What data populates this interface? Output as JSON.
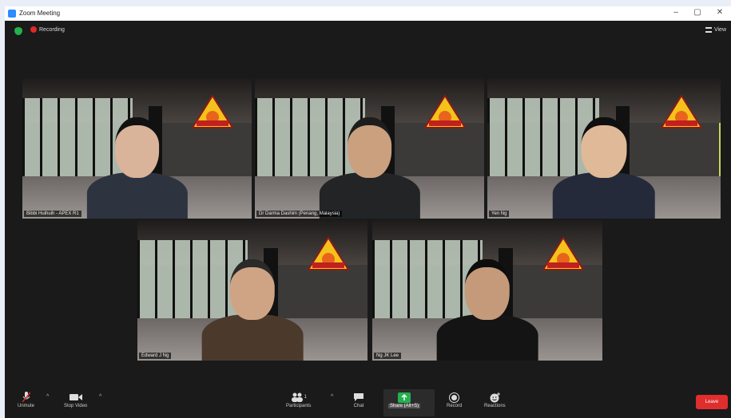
{
  "window": {
    "title": "Zoom Meeting",
    "controls": [
      "–",
      "▢",
      "✕"
    ]
  },
  "topbar": {
    "recording": "Recording",
    "view": "View"
  },
  "participants": [
    {
      "name": "Bibbi Huihuih - APEX R1",
      "skin": "#d9b39a",
      "hair": "#111111",
      "shirt": "#2e3340",
      "active": false
    },
    {
      "name": "Dr Darma Dashim (Penang, Malaysia)",
      "skin": "#caa07f",
      "hair": "#1d1d1d",
      "shirt": "#222426",
      "active": false
    },
    {
      "name": "Yen Ng",
      "skin": "#e0b998",
      "hair": "#0f0f0f",
      "shirt": "#252a3a",
      "active": true
    },
    {
      "name": "Edward J Ng",
      "skin": "#cfa484",
      "hair": "#2a2a2a",
      "shirt": "#4b3a2c",
      "active": false
    },
    {
      "name": "Ng JK Lee",
      "skin": "#c59a7a",
      "hair": "#0d0d0d",
      "shirt": "#141414",
      "active": false
    }
  ],
  "toolbar": {
    "unmute": "Unmute",
    "stop_video": "Stop Video",
    "participants": "Participants",
    "participants_count": "1",
    "chat": "Chat",
    "share": "Share (Alt+S)",
    "record": "Record",
    "reactions": "Reactions",
    "end": "Leave"
  },
  "colors": {
    "active_border": "#c9d45a",
    "end": "#e02d2d",
    "share": "#23b14d",
    "recording": "#e02828"
  }
}
